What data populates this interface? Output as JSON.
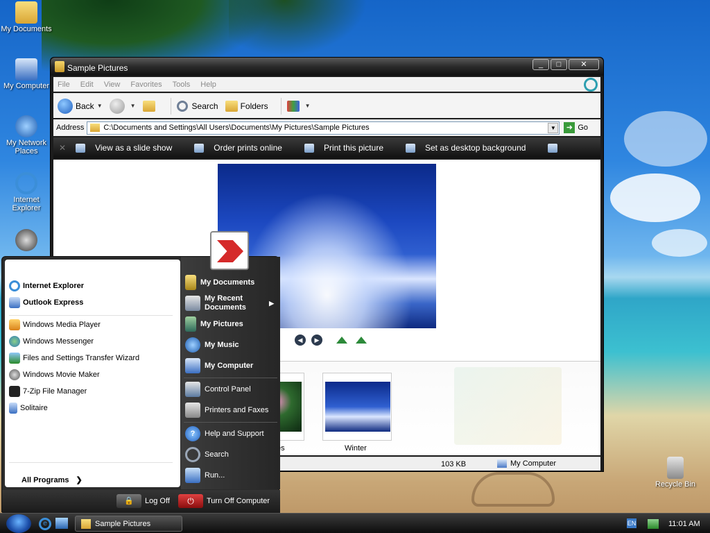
{
  "desktop": {
    "icons": [
      {
        "label": "My Documents",
        "icon": "folder-icon"
      },
      {
        "label": "My Computer",
        "icon": "computer-icon"
      },
      {
        "label": "My Network Places",
        "icon": "network-icon"
      },
      {
        "label": "Internet Explorer",
        "icon": "ie-icon"
      },
      {
        "label": "",
        "icon": "raccoon-icon"
      },
      {
        "label": "Recycle Bin",
        "icon": "recycle-bin-icon"
      }
    ]
  },
  "window": {
    "title": "Sample Pictures",
    "menu": [
      "File",
      "Edit",
      "View",
      "Favorites",
      "Tools",
      "Help"
    ],
    "toolbar": {
      "back": "Back",
      "search": "Search",
      "folders": "Folders"
    },
    "address": {
      "label": "Address",
      "path": "C:\\Documents and Settings\\All Users\\Documents\\My Pictures\\Sample Pictures",
      "go": "Go"
    },
    "tasks": [
      "View as a slide show",
      "Order prints online",
      "Print this picture",
      "Set as desktop background"
    ],
    "thumbnails": [
      {
        "label": "es"
      },
      {
        "label": "Winter"
      }
    ],
    "status": {
      "size": "103 KB",
      "location": "My Computer"
    }
  },
  "start_menu": {
    "pinned": [
      "Internet Explorer",
      "Outlook Express"
    ],
    "recent": [
      "Windows Media Player",
      "Windows Messenger",
      "Files and Settings Transfer Wizard",
      "Windows Movie Maker",
      "7-Zip File Manager",
      "Solitaire"
    ],
    "all_programs": "All Programs",
    "right": [
      "My Documents",
      "My Recent Documents",
      "My Pictures",
      "My Music",
      "My Computer",
      "Control Panel",
      "Printers and Faxes",
      "Help and Support",
      "Search",
      "Run..."
    ],
    "log_off": "Log Off",
    "turn_off": "Turn Off Computer"
  },
  "taskbar": {
    "task": "Sample Pictures",
    "lang": "EN",
    "clock": "11:01 AM"
  },
  "colors": {
    "accent": "#1f5fc0",
    "taskbar": "#1b1b1b",
    "turn_off": "#c62020"
  }
}
